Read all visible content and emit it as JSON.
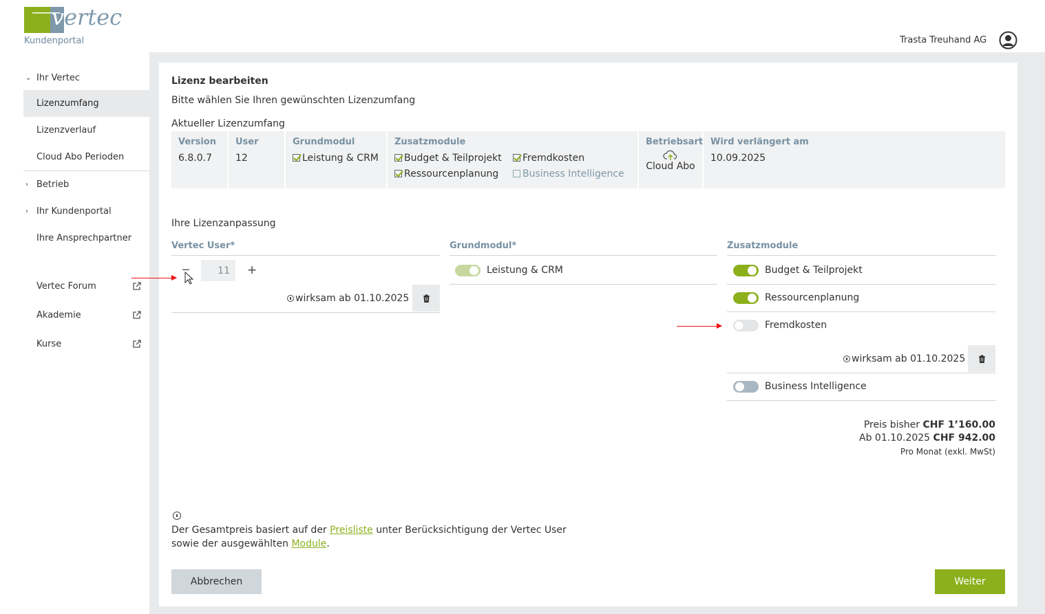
{
  "header": {
    "logo_text": "vertec",
    "portal_label": "Kundenportal",
    "company": "Trasta Treuhand AG",
    "user_icon": "user-circle-icon"
  },
  "sidebar": {
    "groups": [
      {
        "label": "Ihr Vertec",
        "expanded": true
      },
      {
        "label": "Lizenzumfang",
        "active": true
      },
      {
        "label": "Lizenzverlauf"
      },
      {
        "label": "Cloud Abo Perioden"
      },
      {
        "label": "Betrieb",
        "expanded": false
      },
      {
        "label": "Ihr Kundenportal",
        "expanded": false
      },
      {
        "label": "Ihre Ansprechpartner"
      },
      {
        "label": "Vertec Forum",
        "external": true
      },
      {
        "label": "Akademie",
        "external": true
      },
      {
        "label": "Kurse",
        "external": true
      }
    ]
  },
  "main": {
    "title": "Lizenz bearbeiten",
    "subtitle": "Bitte wählen Sie Ihren gewünschten Lizenzumfang",
    "current_heading": "Aktueller Lizenzumfang",
    "current": {
      "version_label": "Version",
      "version": "6.8.0.7",
      "user_label": "User",
      "user": "12",
      "grundmodul_label": "Grundmodul",
      "grundmodul": "Leistung & CRM",
      "zusatz_label": "Zusatzmodule",
      "zusatz": [
        {
          "label": "Budget & Teilprojekt",
          "checked": true
        },
        {
          "label": "Fremdkosten",
          "checked": true
        },
        {
          "label": "Ressourcenplanung",
          "checked": true
        },
        {
          "label": "Business Intelligence",
          "checked": false
        }
      ],
      "betriebsart_label": "Betriebsart",
      "betriebsart": "Cloud Abo",
      "renew_label": "Wird verlängert am",
      "renew": "10.09.2025"
    },
    "adjust_heading": "Ihre Lizenzanpassung",
    "user_col": {
      "label": "Vertec User*",
      "value": "11",
      "effective": "wirksam ab 01.10.2025"
    },
    "grund_col": {
      "label": "Grundmodul*",
      "module": "Leistung & CRM"
    },
    "zusatz_col": {
      "label": "Zusatzmodule",
      "modules": [
        {
          "label": "Budget & Teilprojekt",
          "on": true
        },
        {
          "label": "Ressourcenplanung",
          "on": true
        },
        {
          "label": "Fremdkosten",
          "on": false,
          "effective": "wirksam ab 01.10.2025"
        },
        {
          "label": "Business Intelligence",
          "on": false
        }
      ]
    },
    "price": {
      "prev_label": "Preis bisher",
      "prev_value": "CHF 1’160.00",
      "new_label": "Ab 01.10.2025",
      "new_value": "CHF 942.00",
      "period": "Pro Monat (exkl. MwSt)"
    },
    "note": {
      "text1": "Der Gesamtpreis basiert auf der ",
      "link1": "Preisliste",
      "text2": " unter Berücksichtigung der Vertec User",
      "text3": "sowie der ausgewählten ",
      "link2": "Module",
      "text4": "."
    },
    "buttons": {
      "cancel": "Abbrechen",
      "next": "Weiter"
    },
    "colors": {
      "accent": "#8cb01c",
      "label_blue": "#7891a3"
    }
  }
}
